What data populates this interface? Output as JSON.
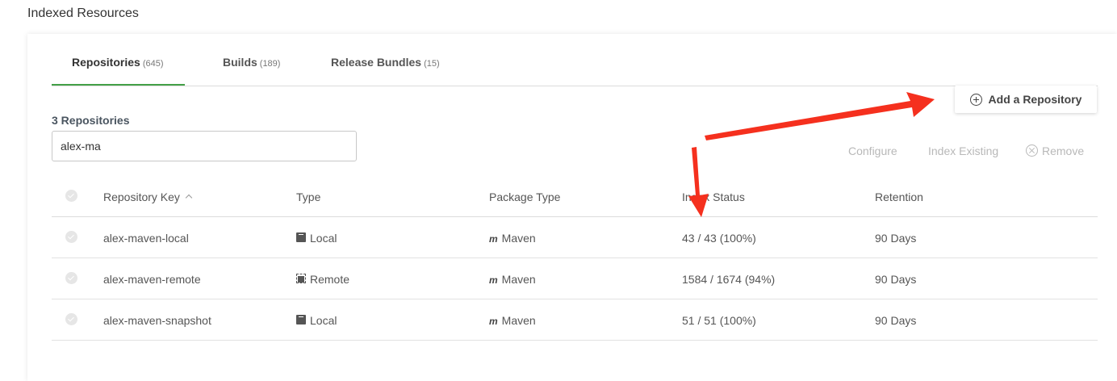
{
  "page": {
    "title": "Indexed Resources"
  },
  "tabs": [
    {
      "label": "Repositories",
      "count": "(645)",
      "active": true
    },
    {
      "label": "Builds",
      "count": "(189)",
      "active": false
    },
    {
      "label": "Release Bundles",
      "count": "(15)",
      "active": false
    }
  ],
  "toolbar": {
    "add_label": "Add a Repository",
    "result_count": "3 Repositories",
    "search_value": "alex-ma",
    "configure_label": "Configure",
    "index_existing_label": "Index Existing",
    "remove_label": "Remove"
  },
  "table": {
    "headers": [
      "Repository Key",
      "Type",
      "Package Type",
      "Index Status",
      "Retention"
    ],
    "rows": [
      {
        "key": "alex-maven-local",
        "type": "Local",
        "type_icon": "local-repo-icon",
        "package": "Maven",
        "status": "43 / 43 (100%)",
        "retention": "90 Days"
      },
      {
        "key": "alex-maven-remote",
        "type": "Remote",
        "type_icon": "remote-repo-icon",
        "package": "Maven",
        "status": "1584 / 1674 (94%)",
        "retention": "90 Days"
      },
      {
        "key": "alex-maven-snapshot",
        "type": "Local",
        "type_icon": "local-repo-icon",
        "package": "Maven",
        "status": "51 / 51 (100%)",
        "retention": "90 Days"
      }
    ]
  },
  "colors": {
    "active_tab": "#43a047",
    "annotation_arrow": "#f5301e"
  },
  "annotations": {
    "arrow_count": 2
  }
}
